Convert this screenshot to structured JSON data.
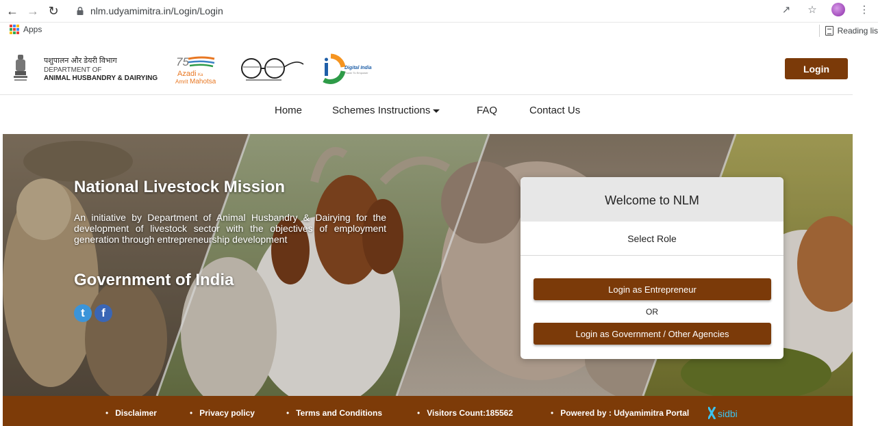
{
  "browser": {
    "url": "nlm.udyamimitra.in/Login/Login",
    "apps_label": "Apps",
    "reading_label": "Reading lis"
  },
  "header": {
    "dept_hindi": "पशुपालन और डेयरी विभाग",
    "dept_line1": "DEPARTMENT OF",
    "dept_line2": "ANIMAL HUSBANDRY & DAIRYING",
    "azadi_75": "75",
    "azadi_word": "Azadi",
    "azadi_ka": "Ka",
    "azadi_amrit": "Amrit",
    "azadi_mahotsav": "Mahotsav",
    "digital_india": "Digital India",
    "digital_tagline": "Power To Empower",
    "login_label": "Login"
  },
  "nav": {
    "home": "Home",
    "schemes": "Schemes Instructions",
    "faq": "FAQ",
    "contact": "Contact Us"
  },
  "hero": {
    "title": "National Livestock Mission",
    "description": "An initiative by Department of Animal Husbandry & Dairying for the development of livestock sector with the objectives of employment generation through entrepreneurship development",
    "gov": "Government of India",
    "twitter_glyph": "t",
    "facebook_glyph": "f"
  },
  "card": {
    "title": "Welcome to NLM",
    "select_role": "Select Role",
    "entrepreneur_btn": "Login as Entrepreneur",
    "or": "OR",
    "gov_btn": "Login as Government / Other Agencies"
  },
  "footer": {
    "disclaimer": "Disclaimer",
    "privacy": "Privacy policy",
    "terms": "Terms and Conditions",
    "visitors": "Visitors Count:185562",
    "powered": "Powered by : Udyamimitra Portal",
    "sidbi": "sidbi"
  },
  "colors": {
    "brand_brown": "#7b3a09",
    "footer_brown": "#7d3b08"
  }
}
